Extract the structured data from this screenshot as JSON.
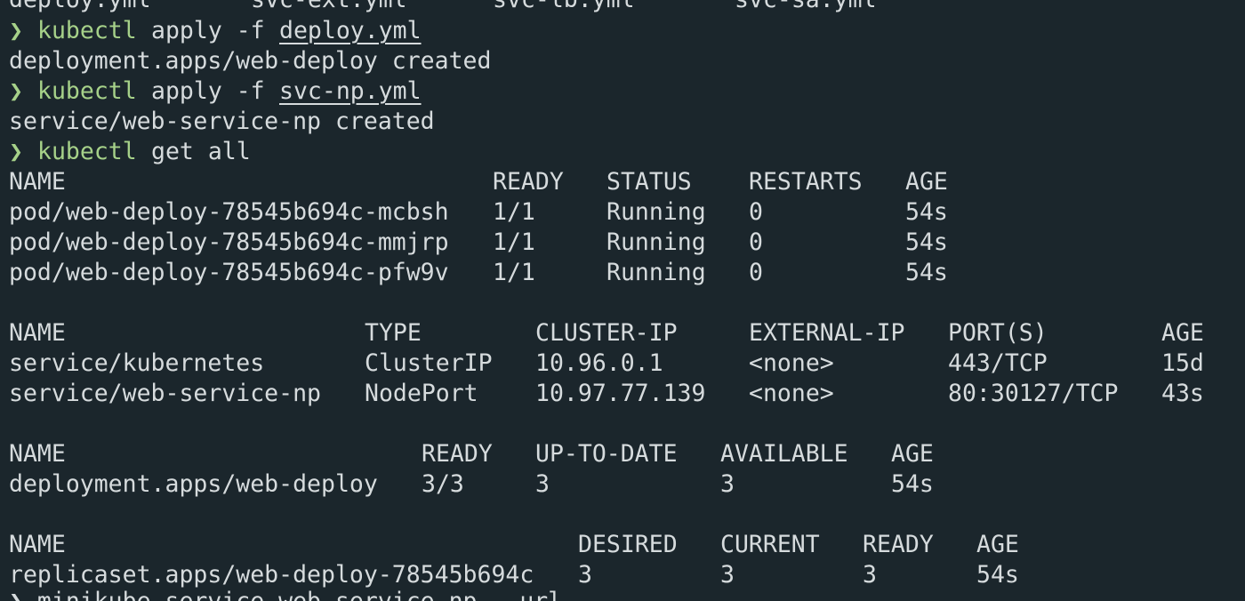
{
  "terminal": {
    "prompt_symbol": "❯",
    "top_partial_files": [
      "deploy.yml",
      "svc-ext.yml",
      "svc-lb.yml",
      "svc-sa.yml"
    ],
    "commands": [
      {
        "program": "kubectl",
        "args": "apply -f",
        "file": "deploy.yml"
      },
      {
        "program": "kubectl",
        "args": "apply -f",
        "file": "svc-np.yml"
      },
      {
        "program": "kubectl",
        "args": "get all",
        "file": ""
      }
    ],
    "outputs": {
      "deploy_created": "deployment.apps/web-deploy created",
      "service_created": "service/web-service-np created"
    },
    "pods": {
      "headers": [
        "NAME",
        "READY",
        "STATUS",
        "RESTARTS",
        "AGE"
      ],
      "rows": [
        [
          "pod/web-deploy-78545b694c-mcbsh",
          "1/1",
          "Running",
          "0",
          "54s"
        ],
        [
          "pod/web-deploy-78545b694c-mmjrp",
          "1/1",
          "Running",
          "0",
          "54s"
        ],
        [
          "pod/web-deploy-78545b694c-pfw9v",
          "1/1",
          "Running",
          "0",
          "54s"
        ]
      ]
    },
    "services": {
      "headers": [
        "NAME",
        "TYPE",
        "CLUSTER-IP",
        "EXTERNAL-IP",
        "PORT(S)",
        "AGE"
      ],
      "rows": [
        [
          "service/kubernetes",
          "ClusterIP",
          "10.96.0.1",
          "<none>",
          "443/TCP",
          "15d"
        ],
        [
          "service/web-service-np",
          "NodePort",
          "10.97.77.139",
          "<none>",
          "80:30127/TCP",
          "43s"
        ]
      ]
    },
    "deployments": {
      "headers": [
        "NAME",
        "READY",
        "UP-TO-DATE",
        "AVAILABLE",
        "AGE"
      ],
      "rows": [
        [
          "deployment.apps/web-deploy",
          "3/3",
          "3",
          "3",
          "54s"
        ]
      ]
    },
    "replicasets": {
      "headers": [
        "NAME",
        "DESIRED",
        "CURRENT",
        "READY",
        "AGE"
      ],
      "rows": [
        [
          "replicaset.apps/web-deploy-78545b694c",
          "3",
          "3",
          "3",
          "54s"
        ]
      ]
    },
    "bottom_partial": "❯ minikube service web-service-np --url"
  },
  "colors": {
    "background": "#1b262c",
    "foreground": "#d6dbdd",
    "accent_green": "#a6d189"
  }
}
